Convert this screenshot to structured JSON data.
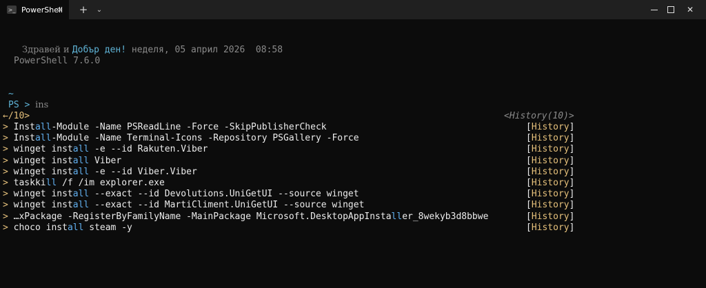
{
  "tab": {
    "title": "PowerShell",
    "icon_glyph": ">_",
    "close_glyph": "✕",
    "new_tab_glyph": "+",
    "dropdown_glyph": "⌄"
  },
  "window_controls": {
    "close_glyph": "✕"
  },
  "greeting": {
    "prefix": "Здравей и ",
    "highlight": "Добър ден!",
    "date": " неделя, 05 април 2026  08:58",
    "version": "PowerShell 7.6.0"
  },
  "prompt": {
    "path": "~",
    "ps": "PS >",
    "input": "ins"
  },
  "history_menu": {
    "pager": "←/10>",
    "header": "<History(10)>",
    "pointer": ">",
    "tag_open": "[",
    "tag_text": "History",
    "tag_close": "]",
    "items": [
      {
        "pre": "Inst",
        "match": "all",
        "post": "-Module -Name PSReadLine -Force -SkipPublisherCheck"
      },
      {
        "pre": "Inst",
        "match": "all",
        "post": "-Module -Name Terminal-Icons -Repository PSGallery -Force"
      },
      {
        "pre": "winget inst",
        "match": "all",
        "post": " -e --id Rakuten.Viber"
      },
      {
        "pre": "winget inst",
        "match": "all",
        "post": " Viber"
      },
      {
        "pre": "winget inst",
        "match": "all",
        "post": " -e --id Viber.Viber"
      },
      {
        "pre": "taskki",
        "match": "ll",
        "post": " /f /im explorer.exe"
      },
      {
        "pre": "winget inst",
        "match": "all",
        "post": " --exact --id Devolutions.UniGetUI --source winget"
      },
      {
        "pre": "winget inst",
        "match": "all",
        "post": " --exact --id MartiCliment.UniGetUI --source winget"
      },
      {
        "pre": "…xPackage -RegisterByFamilyName -MainPackage Microsoft.DesktopAppInsta",
        "match": "ll",
        "post": "er_8wekyb3d8bbwe"
      },
      {
        "pre": "choco inst",
        "match": "all",
        "post": " steam -y"
      }
    ]
  },
  "colors": {
    "background": "#0c0c0c",
    "titlebar": "#202020",
    "pointer": "#e5c07b",
    "match": "#61afef",
    "tag_text": "#e5c07b"
  }
}
